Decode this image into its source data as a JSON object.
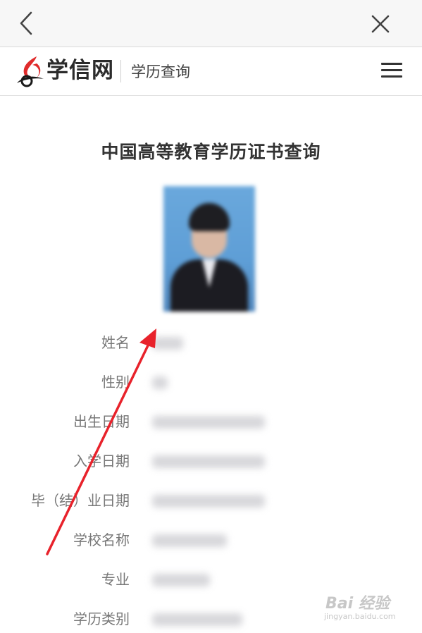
{
  "browser": {
    "back_icon": "chevron-left-icon",
    "close_icon": "close-icon"
  },
  "header": {
    "site_name": "学信网",
    "subtitle": "学历查询",
    "menu_icon": "hamburger-menu-icon",
    "logo_icon": "xuexin-logo-icon",
    "brand_color": "#e02b2b"
  },
  "main": {
    "title": "中国高等教育学历证书查询",
    "fields": [
      {
        "label": "姓名"
      },
      {
        "label": "性别"
      },
      {
        "label": "出生日期"
      },
      {
        "label": "入学日期"
      },
      {
        "label": "毕（结）业日期"
      },
      {
        "label": "学校名称"
      },
      {
        "label": "专业"
      },
      {
        "label": "学历类别"
      }
    ]
  },
  "annotation": {
    "arrow_color": "#e8222b"
  },
  "watermark": {
    "main": "Bai 经验",
    "sub": "jingyan.baidu.com"
  }
}
